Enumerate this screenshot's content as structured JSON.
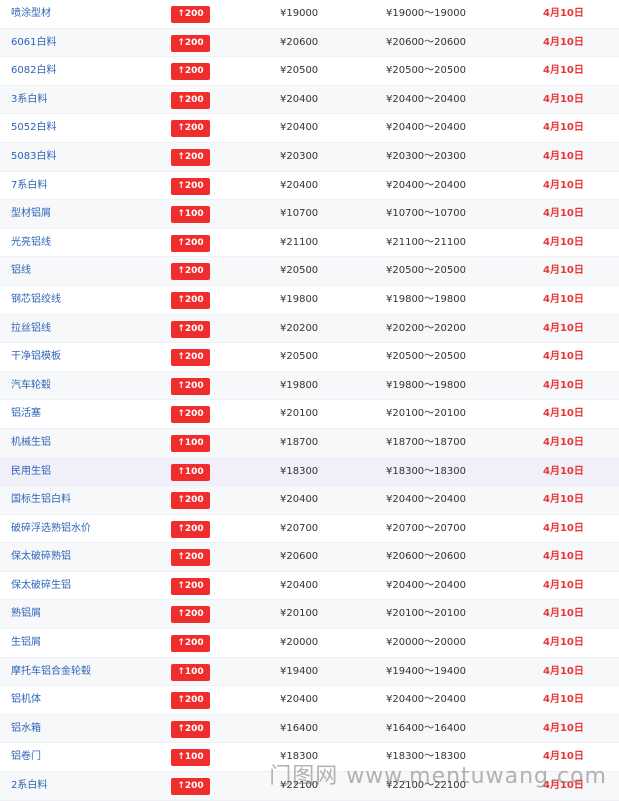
{
  "rows": [
    {
      "name": "喷涂型材",
      "change": "↑200",
      "price": "¥19000",
      "range": "¥19000～19000",
      "date": "4月10日"
    },
    {
      "name": "6061白料",
      "change": "↑200",
      "price": "¥20600",
      "range": "¥20600～20600",
      "date": "4月10日"
    },
    {
      "name": "6082白料",
      "change": "↑200",
      "price": "¥20500",
      "range": "¥20500～20500",
      "date": "4月10日"
    },
    {
      "name": "3系白料",
      "change": "↑200",
      "price": "¥20400",
      "range": "¥20400～20400",
      "date": "4月10日"
    },
    {
      "name": "5052白料",
      "change": "↑200",
      "price": "¥20400",
      "range": "¥20400～20400",
      "date": "4月10日"
    },
    {
      "name": "5083白料",
      "change": "↑200",
      "price": "¥20300",
      "range": "¥20300～20300",
      "date": "4月10日"
    },
    {
      "name": "7系白料",
      "change": "↑200",
      "price": "¥20400",
      "range": "¥20400～20400",
      "date": "4月10日"
    },
    {
      "name": "型材铝屑",
      "change": "↑100",
      "price": "¥10700",
      "range": "¥10700～10700",
      "date": "4月10日"
    },
    {
      "name": "光亮铝线",
      "change": "↑200",
      "price": "¥21100",
      "range": "¥21100～21100",
      "date": "4月10日"
    },
    {
      "name": "铝线",
      "change": "↑200",
      "price": "¥20500",
      "range": "¥20500～20500",
      "date": "4月10日"
    },
    {
      "name": "钢芯铝绞线",
      "change": "↑200",
      "price": "¥19800",
      "range": "¥19800～19800",
      "date": "4月10日"
    },
    {
      "name": "拉丝铝线",
      "change": "↑200",
      "price": "¥20200",
      "range": "¥20200～20200",
      "date": "4月10日"
    },
    {
      "name": "干净铝模板",
      "change": "↑200",
      "price": "¥20500",
      "range": "¥20500～20500",
      "date": "4月10日"
    },
    {
      "name": "汽车轮毂",
      "change": "↑200",
      "price": "¥19800",
      "range": "¥19800～19800",
      "date": "4月10日"
    },
    {
      "name": "铝活塞",
      "change": "↑200",
      "price": "¥20100",
      "range": "¥20100～20100",
      "date": "4月10日"
    },
    {
      "name": "机械生铝",
      "change": "↑100",
      "price": "¥18700",
      "range": "¥18700～18700",
      "date": "4月10日"
    },
    {
      "name": "民用生铝",
      "change": "↑100",
      "price": "¥18300",
      "range": "¥18300～18300",
      "date": "4月10日"
    },
    {
      "name": "国标生铝白料",
      "change": "↑200",
      "price": "¥20400",
      "range": "¥20400～20400",
      "date": "4月10日"
    },
    {
      "name": "破碎浮选熟铝水价",
      "change": "↑200",
      "price": "¥20700",
      "range": "¥20700～20700",
      "date": "4月10日"
    },
    {
      "name": "保太破碎熟铝",
      "change": "↑200",
      "price": "¥20600",
      "range": "¥20600～20600",
      "date": "4月10日"
    },
    {
      "name": "保太破碎生铝",
      "change": "↑200",
      "price": "¥20400",
      "range": "¥20400～20400",
      "date": "4月10日"
    },
    {
      "name": "熟铝屑",
      "change": "↑200",
      "price": "¥20100",
      "range": "¥20100～20100",
      "date": "4月10日"
    },
    {
      "name": "生铝屑",
      "change": "↑200",
      "price": "¥20000",
      "range": "¥20000～20000",
      "date": "4月10日"
    },
    {
      "name": "摩托车铝合金轮毂",
      "change": "↑100",
      "price": "¥19400",
      "range": "¥19400～19400",
      "date": "4月10日"
    },
    {
      "name": "铝机体",
      "change": "↑200",
      "price": "¥20400",
      "range": "¥20400～20400",
      "date": "4月10日"
    },
    {
      "name": "铝水箱",
      "change": "↑200",
      "price": "¥16400",
      "range": "¥16400～16400",
      "date": "4月10日"
    },
    {
      "name": "铝卷门",
      "change": "↑100",
      "price": "¥18300",
      "range": "¥18300～18300",
      "date": "4月10日"
    },
    {
      "name": "2系白料",
      "change": "↑200",
      "price": "¥22100",
      "range": "¥22100～22100",
      "date": "4月10日"
    }
  ],
  "highlight_row_index": 16,
  "watermark": "门图网 www.mentuwang.com"
}
